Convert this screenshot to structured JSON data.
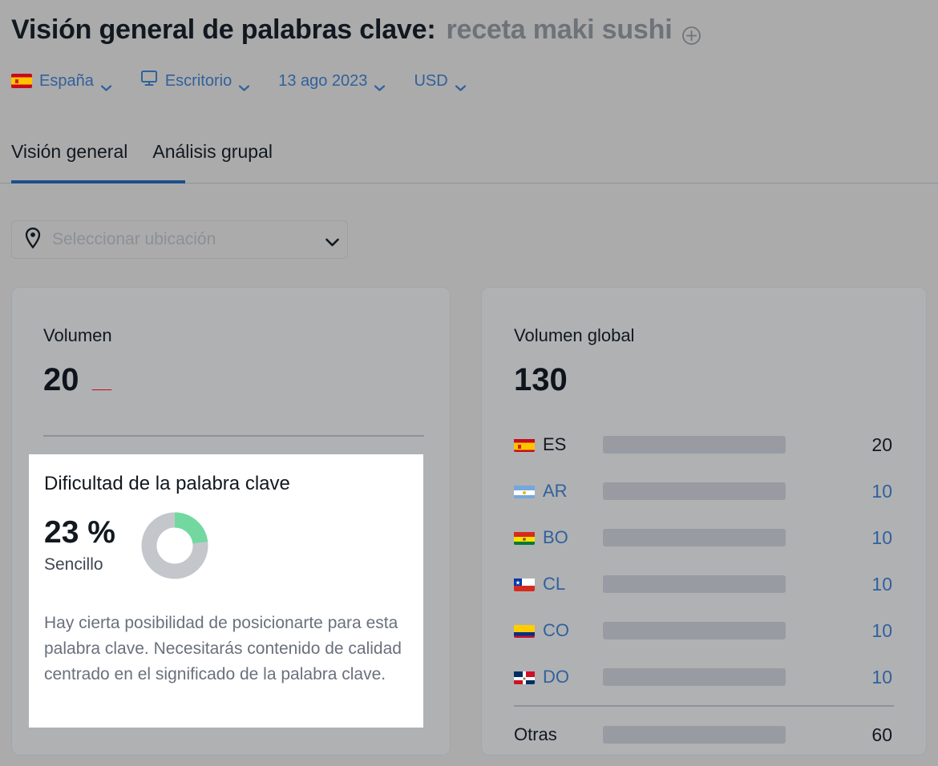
{
  "header": {
    "title_prefix": "Visión general de palabras clave:",
    "keyword": "receta maki sushi",
    "add_icon": "plus-circle-icon",
    "filters": [
      {
        "label": "España",
        "icon": "flag-es-icon"
      },
      {
        "label": "Escritorio",
        "icon": "monitor-icon"
      },
      {
        "label": "13 ago 2023",
        "icon": ""
      },
      {
        "label": "USD",
        "icon": ""
      }
    ]
  },
  "tabs": [
    {
      "label": "Visión general",
      "active": true
    },
    {
      "label": "Análisis grupal",
      "active": false
    }
  ],
  "location_select": {
    "placeholder": "Seleccionar ubicación",
    "icon": "location-pin-icon",
    "chevron": "chevron-down-icon"
  },
  "volume_card": {
    "label": "Volumen",
    "value": "20",
    "flag": "flag-es-icon"
  },
  "keyword_difficulty": {
    "title": "Dificultad de la palabra clave",
    "percent": "23 %",
    "level": "Sencillo",
    "description": "Hay cierta posibilidad de posicionarte para esta palabra clave. Necesitarás contenido de calidad centrado en el significado de la palabra clave.",
    "donut_value": 23,
    "donut_color": "#73d8a0",
    "donut_track_color": "#c3c7cc"
  },
  "global_volume": {
    "label": "Volumen global",
    "value": "130",
    "colors": {
      "primary_bar": "#1f4f8f",
      "country_bar": "#4189c0",
      "other_bar": "#3e86bf",
      "track": "#989ba1"
    },
    "rows": [
      {
        "code": "ES",
        "flag": "flag-es-icon",
        "value": "20",
        "ratio": 0.175,
        "primary": true
      },
      {
        "code": "AR",
        "flag": "flag-ar-icon",
        "value": "10",
        "ratio": 0.088,
        "primary": false
      },
      {
        "code": "BO",
        "flag": "flag-bo-icon",
        "value": "10",
        "ratio": 0.088,
        "primary": false
      },
      {
        "code": "CL",
        "flag": "flag-cl-icon",
        "value": "10",
        "ratio": 0.088,
        "primary": false
      },
      {
        "code": "CO",
        "flag": "flag-co-icon",
        "value": "10",
        "ratio": 0.088,
        "primary": false
      },
      {
        "code": "DO",
        "flag": "flag-do-icon",
        "value": "10",
        "ratio": 0.088,
        "primary": false
      }
    ],
    "other_row": {
      "code": "Otras",
      "value": "60",
      "ratio": 0.48
    }
  }
}
